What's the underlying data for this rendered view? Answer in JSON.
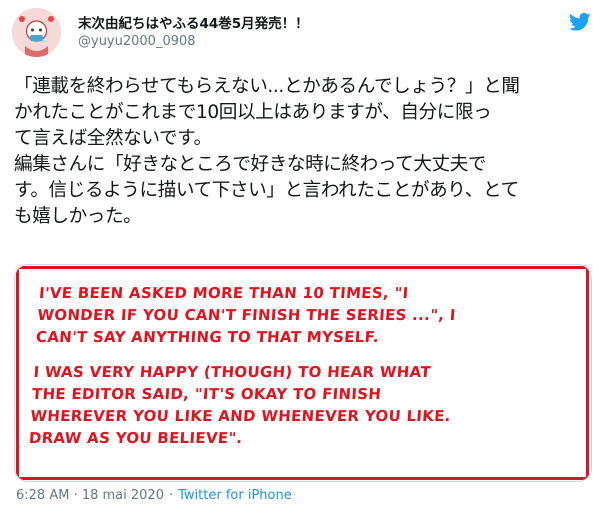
{
  "author": {
    "display_name": "末次由紀ちはやふる44巻5月発売！！",
    "handle": "@yuyu2000_0908",
    "avatar_icon": "avatar-icon"
  },
  "logo_icon": "twitter-bird-icon",
  "colors": {
    "twitter_blue": "#1da1f2",
    "link_blue": "#1b95e0",
    "translation_red": "#e0141e",
    "secondary_text": "#657786"
  },
  "tweet_lines": [
    "「連載を終わらせてもらえない...とかあるんでしょう？」と聞",
    "かれたことがこれまで10回以上はありますが、自分に限っ",
    "て言えば全然ないです。",
    "編集さんに「好きなところで好きな時に終わって大丈夫で",
    "す。信じるように描いて下さい」と言われたことがあり、とて",
    "も嬉しかった。"
  ],
  "translation": {
    "paragraph1": [
      "I've been asked more than 10 times, \"I",
      "wonder if you can't finish the series ...\", I",
      "can't say anything to that myself."
    ],
    "paragraph2": [
      "I was very happy (though) to hear what",
      "the editor said, \"It's okay to finish",
      "wherever you like and whenever you like.",
      "Draw as you believe\"."
    ]
  },
  "meta": {
    "time": "6:28 AM",
    "separator": "·",
    "date": "18 mai 2020",
    "source": "Twitter for iPhone"
  }
}
